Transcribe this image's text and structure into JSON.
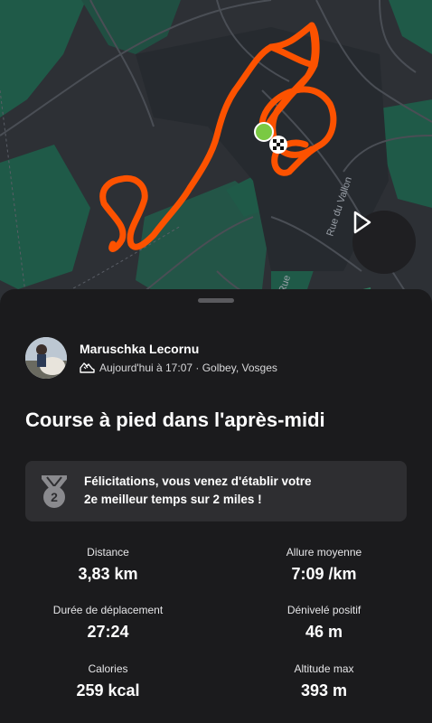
{
  "map": {
    "street_label_1": "Rue du Vallon",
    "street_label_2": "Rue",
    "play_icon": "play-icon"
  },
  "athlete": {
    "name": "Maruschka Lecornu",
    "activity_icon": "running-shoe-icon",
    "datetime_location": "Aujourd'hui à 17:07 · Golbey, Vosges"
  },
  "activity": {
    "title": "Course à pied dans l'après-midi"
  },
  "achievement": {
    "icon": "medal-icon",
    "rank": "2",
    "line1": "Félicitations, vous venez d'établir votre",
    "line2": "2e meilleur temps sur 2 miles !"
  },
  "stats": [
    {
      "label": "Distance",
      "value": "3,83 km"
    },
    {
      "label": "Allure moyenne",
      "value": "7:09 /km"
    },
    {
      "label": "Durée de déplacement",
      "value": "27:24"
    },
    {
      "label": "Dénivelé positif",
      "value": "46 m"
    },
    {
      "label": "Calories",
      "value": "259 kcal"
    },
    {
      "label": "Altitude max",
      "value": "393 m"
    }
  ],
  "colors": {
    "route": "#fc5200",
    "start": "#7ac943",
    "green_area": "#1f5a48",
    "map_bg": "#2d3035"
  }
}
